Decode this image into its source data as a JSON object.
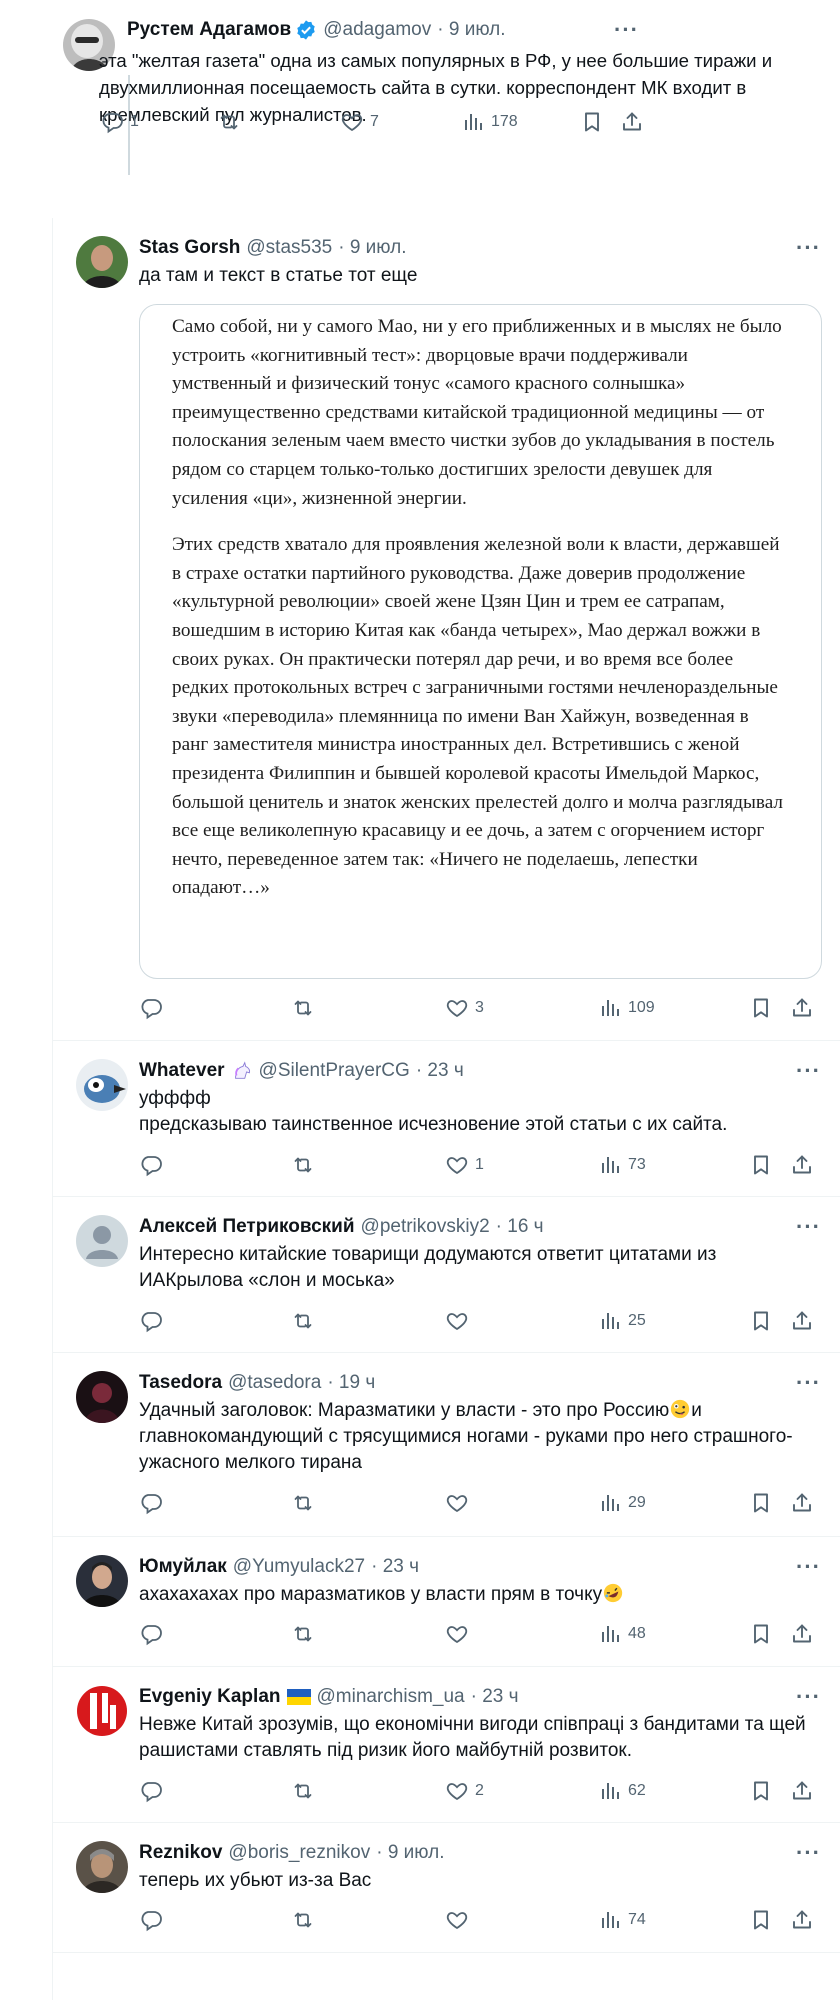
{
  "tweets": [
    {
      "name": "Рустем Адагамов",
      "handle": "@adagamov",
      "time": "· 9 июл.",
      "text": "эта \"желтая газета\" одна из самых популярных в РФ, у нее большие тиражи и двухмиллионная посещаемость сайта в сутки. корреспондент МК входит в кремлевский пул журналистов.",
      "replies": "1",
      "likes": "7",
      "views": "178"
    },
    {
      "name": "Stas Gorsh",
      "handle": "@stas535",
      "time": "· 9 июл.",
      "text": "да там и текст в статье тот еще",
      "quote_p1": "Само собой, ни у самого Мао, ни у его приближенных и в мыслях не было устроить «когнитивный тест»: дворцовые врачи поддерживали умственный и физический тонус «самого красного солнышка» преимущественно средствами китайской традиционной медицины — от полоскания зеленым чаем вместо чистки зубов до укладывания в постель рядом со старцем только-только достигших зрелости девушек для усиления «ци», жизненной энергии.",
      "quote_p2": "Этих средств хватало для проявления железной воли к власти, державшей в страхе остатки партийного руководства. Даже доверив продолжение «культурной революции» своей жене Цзян Цин и трем ее сатрапам, вошедшим в историю Китая как «банда четырех», Мао держал вожжи в своих руках. Он практически потерял дар речи, и во время все более редких протокольных встреч с заграничными гостями нечленораздельные звуки «переводила» племянница по имени Ван Хайжун, возведенная в ранг заместителя министра иностранных дел. Встретившись с женой президента Филиппин и бывшей королевой красоты Имельдой Маркос, большой ценитель и знаток женских прелестей долго и молча разглядывал все еще великолепную красавицу и ее дочь, а затем с огорчением исторг нечто, переведенное затем так: «Ничего не поделаешь, лепестки опадают…»",
      "replies": "",
      "likes": "3",
      "views": "109"
    },
    {
      "name": "Whatever",
      "handle": "@SilentPrayerCG",
      "time": "· 23 ч",
      "text_line1": "уфффф",
      "text_line2": "предсказываю таинственное исчезновение этой статьи с их сайта.",
      "replies": "",
      "likes": "1",
      "views": "73"
    },
    {
      "name": "Алексей Петриковский",
      "handle": "@petrikovskiy2",
      "time": "· 16 ч",
      "text": "Интересно китайские товарищи додумаются ответит цитатами из ИАКрылова «слон и моська»",
      "replies": "",
      "likes": "",
      "views": "25"
    },
    {
      "name": "Tasedora",
      "handle": "@tasedora",
      "time": "· 19 ч",
      "text_a": "Удачный заголовок: Маразматики у власти - это про Россию",
      "text_b": "и главнокомандующий с трясущимися ногами - руками про него страшного-ужасного мелкого тирана",
      "replies": "",
      "likes": "",
      "views": "29"
    },
    {
      "name": "Юмуйлак",
      "handle": "@Yumyulack27",
      "time": "· 23 ч",
      "text": "ахахахахах про маразматиков у власти прям в точку",
      "replies": "",
      "likes": "",
      "views": "48"
    },
    {
      "name": "Evgeniy Kaplan",
      "handle": "@minarchism_ua",
      "time": "· 23 ч",
      "text": "Невже Китай зрозумів, що економічни вигоди співпраці з бандитами та щей рашистами ставлять під ризик його майбутній розвиток.",
      "replies": "",
      "likes": "2",
      "views": "62"
    },
    {
      "name": "Reznikov",
      "handle": "@boris_reznikov",
      "time": "· 9 июл.",
      "text": "теперь их убьют из-за Вас",
      "replies": "",
      "likes": "",
      "views": "74"
    }
  ],
  "more_glyph": "···",
  "colors": {
    "accent": "#1d9bf0",
    "muted": "#536471",
    "border": "#eff3f4"
  }
}
